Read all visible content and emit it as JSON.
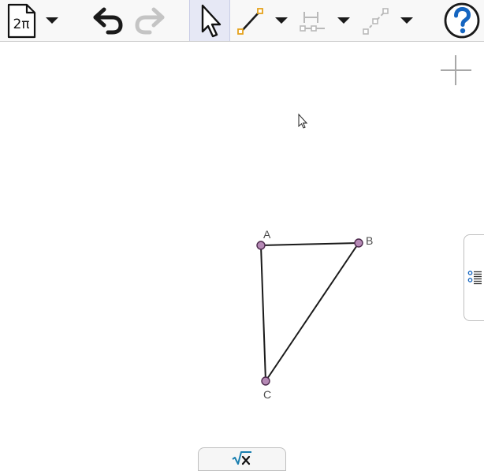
{
  "toolbar": {
    "file_icon_label": "2π",
    "icons": {
      "file": "file-pi-icon",
      "undo": "undo-icon",
      "redo": "redo-icon",
      "move": "arrow-pointer-icon",
      "segment": "segment-icon",
      "perpendicular": "perpendicular-bisector-icon",
      "dashed": "dashed-segment-icon",
      "help": "help-icon"
    }
  },
  "canvas": {
    "points": [
      {
        "name": "A",
        "label": "A"
      },
      {
        "name": "B",
        "label": "B"
      },
      {
        "name": "C",
        "label": "C"
      }
    ]
  },
  "colors": {
    "point_fill": "#b589b5",
    "point_stroke": "#4d2a4d",
    "segment": "#1a1a1a",
    "help": "#1565c0",
    "accent_orange": "#e5a21b",
    "selected_bg": "#e6e8f5"
  }
}
